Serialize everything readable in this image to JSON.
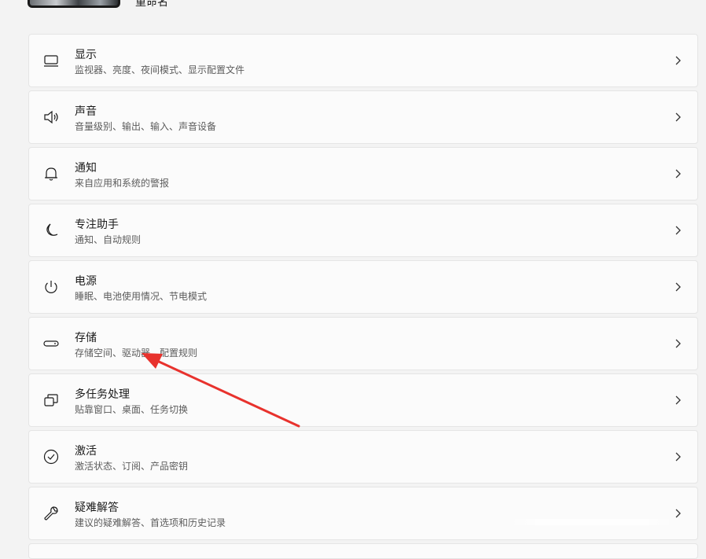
{
  "device": {
    "rename_label": "重命名"
  },
  "settings": [
    {
      "icon": "monitor-icon",
      "title": "显示",
      "subtitle": "监视器、亮度、夜间模式、显示配置文件"
    },
    {
      "icon": "speaker-icon",
      "title": "声音",
      "subtitle": "音量级别、输出、输入、声音设备"
    },
    {
      "icon": "bell-icon",
      "title": "通知",
      "subtitle": "来自应用和系统的警报"
    },
    {
      "icon": "moon-icon",
      "title": "专注助手",
      "subtitle": "通知、自动规则"
    },
    {
      "icon": "power-icon",
      "title": "电源",
      "subtitle": "睡眠、电池使用情况、节电模式"
    },
    {
      "icon": "storage-drive-icon",
      "title": "存储",
      "subtitle": "存储空间、驱动器、配置规则"
    },
    {
      "icon": "multitask-windows-icon",
      "title": "多任务处理",
      "subtitle": "贴靠窗口、桌面、任务切换"
    },
    {
      "icon": "activation-check-icon",
      "title": "激活",
      "subtitle": "激活状态、订阅、产品密钥"
    },
    {
      "icon": "wrench-icon",
      "title": "疑难解答",
      "subtitle": "建议的疑难解答、首选项和历史记录"
    }
  ],
  "colors": {
    "background": "#f3f3f3",
    "card": "#fbfbfb",
    "annotation_arrow": "#e8322d"
  }
}
